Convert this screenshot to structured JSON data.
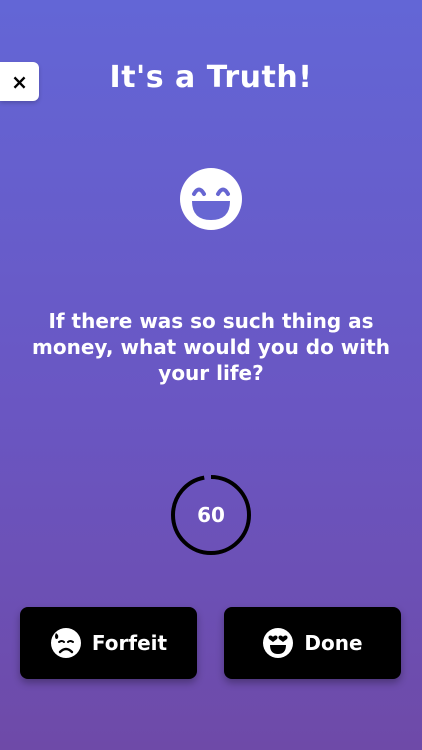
{
  "header": {
    "close_label": "×",
    "title": "It's a Truth!"
  },
  "prompt": {
    "emoji_icon": "grinning-face-icon",
    "question": "If there was so such thing as money, what would you do with your life?"
  },
  "timer": {
    "seconds": "60",
    "progress_fraction": 0.97
  },
  "actions": {
    "forfeit_label": "Forfeit",
    "forfeit_icon": "sad-sweat-face-icon",
    "done_label": "Done",
    "done_icon": "heart-eyes-face-icon"
  },
  "colors": {
    "bg_top": "#6366d6",
    "bg_bottom": "#6e4aa8",
    "button_bg": "#000000",
    "text": "#ffffff"
  }
}
